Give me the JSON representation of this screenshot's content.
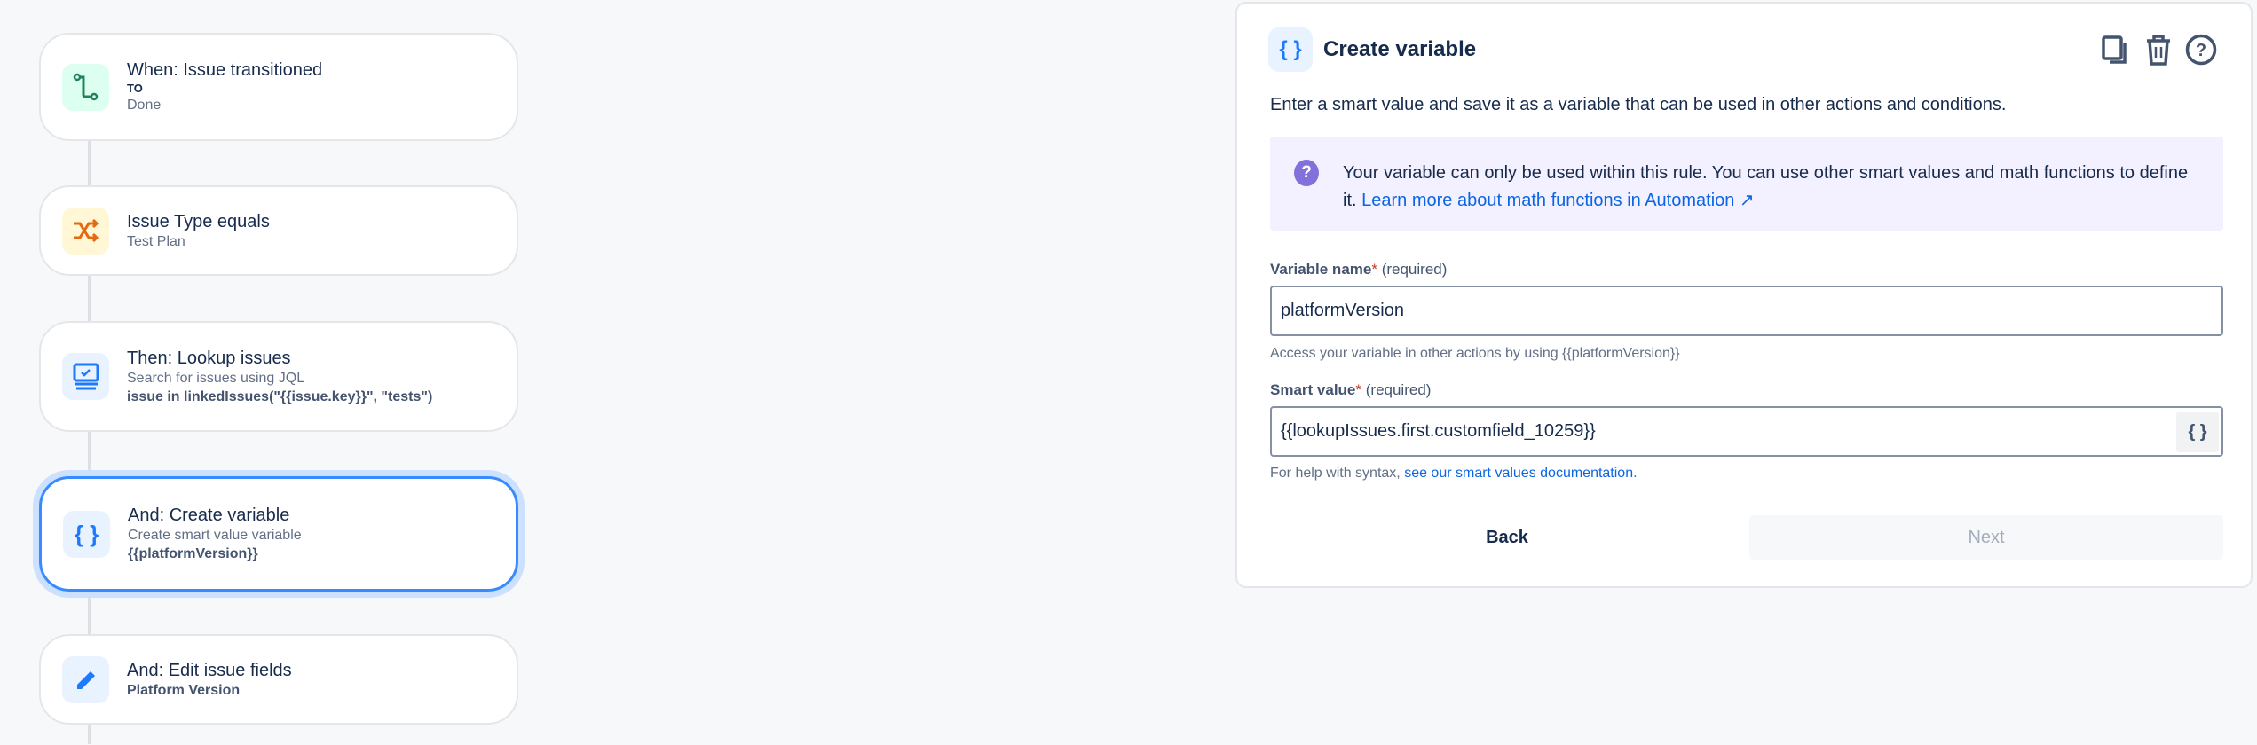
{
  "flow": {
    "cards": [
      {
        "title": "When: Issue transitioned",
        "lines": [
          {
            "text": "TO",
            "style": "k"
          },
          {
            "text": "Done",
            "style": "s"
          }
        ],
        "icon": "transition-icon",
        "iconBg": "#dcfff1",
        "iconColor": "#1f845a"
      },
      {
        "title": "Issue Type equals",
        "lines": [
          {
            "text": "Test Plan",
            "style": "s"
          }
        ],
        "icon": "shuffle-icon",
        "iconBg": "#fff7d6",
        "iconColor": "#e56910"
      },
      {
        "title": "Then: Lookup issues",
        "lines": [
          {
            "text": "Search for issues using JQL",
            "style": "s"
          },
          {
            "text": "issue in linkedIssues(\"{{issue.key}}\", \"tests\")",
            "style": "b"
          }
        ],
        "icon": "lookup-icon",
        "iconBg": "#e9f2ff",
        "iconColor": "#1d7afc"
      },
      {
        "title": "And: Create variable",
        "lines": [
          {
            "text": "Create smart value variable",
            "style": "s"
          },
          {
            "text": "{{platformVersion}}",
            "style": "b"
          }
        ],
        "icon": "braces-icon",
        "iconBg": "#e9f2ff",
        "iconColor": "#1d7afc",
        "selected": true
      },
      {
        "title": "And: Edit issue fields",
        "lines": [
          {
            "text": "Platform Version",
            "style": "b"
          }
        ],
        "icon": "pencil-icon",
        "iconBg": "#e9f2ff",
        "iconColor": "#1d7afc"
      }
    ]
  },
  "panel": {
    "title": "Create variable",
    "brace_glyph": "{ }",
    "description": "Enter a smart value and save it as a variable that can be used in other actions and conditions.",
    "info": {
      "text": "Your variable can only be used within this rule. You can use other smart values and math functions to define it.",
      "link": "Learn more about math functions in Automation ↗"
    },
    "variable_name": {
      "label": "Variable name",
      "asterisk": "*",
      "required": "(required)",
      "value": "platformVersion",
      "helper": "Access your variable in other actions by using {{platformVersion}}"
    },
    "smart_value": {
      "label": "Smart value",
      "asterisk": "*",
      "required": "(required)",
      "value": "{{lookupIssues.first.customfield_10259}}",
      "helper": "For help with syntax,",
      "helper_link": "see our smart values documentation."
    },
    "back_label": "Back",
    "next_label": "Next"
  }
}
